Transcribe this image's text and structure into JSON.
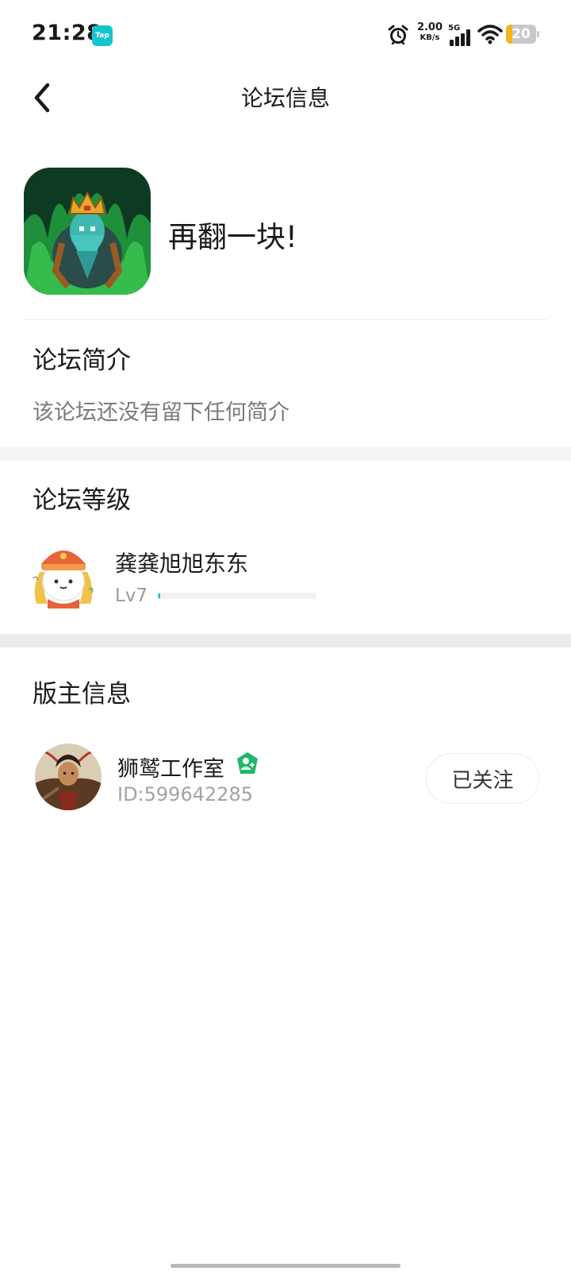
{
  "status_bar": {
    "time": "21:28",
    "app_badge": "Tap",
    "net_speed_value": "2.00",
    "net_speed_unit": "KB/s",
    "network_type": "5G",
    "battery_level": "20",
    "battery_fraction": 0.2,
    "icons": [
      "alarm-icon",
      "signal-icon",
      "wifi-icon",
      "battery-icon"
    ]
  },
  "header": {
    "title": "论坛信息",
    "back_icon": "chevron-left-icon"
  },
  "forum": {
    "name": "再翻一块!"
  },
  "intro": {
    "heading": "论坛简介",
    "text": "该论坛还没有留下任何简介"
  },
  "level": {
    "heading": "论坛等级",
    "user_name": "龚龚旭旭东东",
    "level_label": "Lv7",
    "progress_fraction": 0.01
  },
  "moderator": {
    "heading": "版主信息",
    "name": "狮鹫工作室",
    "id_label": "ID:599642285",
    "follow_label": "已关注",
    "badge_icon": "verified-badge-icon"
  },
  "colors": {
    "accent": "#19c7c3",
    "verified_green": "#1fb86a",
    "battery": "#f6b51e",
    "section_gap": "#f4f5f6"
  }
}
